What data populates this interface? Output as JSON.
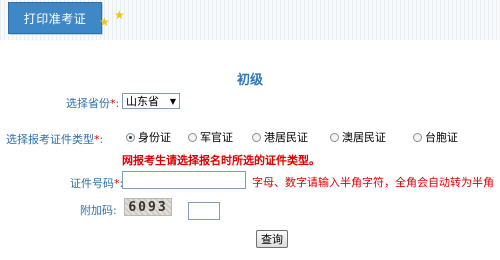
{
  "header": {
    "tab_label": "打印准考证"
  },
  "form": {
    "title": "初级",
    "province": {
      "label": "选择省份",
      "required_mark": "*",
      "colon": ":",
      "value": "山东省"
    },
    "id_type": {
      "label": "选择报考证件类型",
      "required_mark": "*",
      "colon": ":",
      "options": [
        "身份证",
        "军官证",
        "港居民证",
        "澳居民证",
        "台胞证"
      ],
      "selected_index": 0
    },
    "warning": "网报考生请选择报名时所选的证件类型。",
    "id_number": {
      "label": "证件号码",
      "required_mark": "*",
      "colon": ":",
      "value": "",
      "hint": "字母、数字请输入半角字符，全角会自动转为半角"
    },
    "captcha": {
      "label": "附加码",
      "colon": ":",
      "image_text": "6093",
      "value": ""
    },
    "submit_label": "查询"
  },
  "colors": {
    "tab_bg": "#3f88c8",
    "label": "#2f6fb0",
    "required": "#e00000",
    "title": "#2f79b6"
  }
}
